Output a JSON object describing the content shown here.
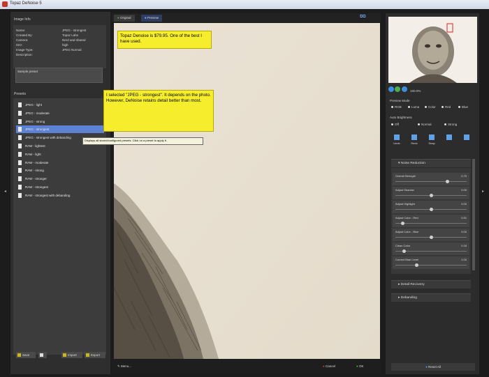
{
  "window": {
    "title": "Topaz DeNoise 5"
  },
  "image_info": {
    "header": "Image Info",
    "rows": [
      {
        "k": "Name:",
        "v": "JPEG - strongest"
      },
      {
        "k": "Created By:",
        "v": "Topaz Labs"
      },
      {
        "k": "Camera:",
        "v": "Nerd and shared"
      },
      {
        "k": "ISO:",
        "v": "high"
      },
      {
        "k": "Image Type:",
        "v": "JPEG Normal"
      },
      {
        "k": "Description:",
        "v": ""
      }
    ],
    "description": "Sample preset"
  },
  "presets": {
    "header": "Presets",
    "items": [
      "JPEG - light",
      "JPEG - moderate",
      "JPEG - strong",
      "JPEG - strongest",
      "JPEG - strongest with debanding",
      "RAW - lightest",
      "RAW - light",
      "RAW - moderate",
      "RAW - strong",
      "RAW - stronger",
      "RAW - strongest",
      "RAW - strongest with debanding"
    ],
    "selected_index": 3,
    "tooltip": "Displays all stored/configured presets. Click on a preset to apply it."
  },
  "left_buttons": {
    "save": "Save",
    "import": "Import",
    "export": "Export"
  },
  "tabs": [
    {
      "label": "Original"
    },
    {
      "label": "Preview"
    }
  ],
  "notes": {
    "note1": "Topaz Denoise is $79.95. One of the best I have used.",
    "note2": "I selected \"JPEG - strongest\". It depends on the photo. However, DeNoise retains detail better than most."
  },
  "center_buttons": {
    "menu": "Menu...",
    "cancel": "Cancel",
    "ok": "OK"
  },
  "right": {
    "zoom_label": "100.0%",
    "preview_mode": {
      "label": "Preview Mode",
      "options": [
        "RGB",
        "Luma",
        "Color",
        "Red",
        "Blue"
      ]
    },
    "auto_brightness": {
      "label": "Auto Brightness",
      "options": [
        "Off",
        "Normal",
        "Strong"
      ]
    },
    "tools": [
      "Undo",
      "Redo",
      "Snap",
      "",
      ""
    ],
    "sections": [
      "Noise Reduction",
      "Detail Recovery",
      "Debanding"
    ],
    "sliders": [
      {
        "label": "Overall Strength",
        "value": "0.70",
        "pos": 0.73
      },
      {
        "label": "Adjust Shadow",
        "value": "0.00",
        "pos": 0.5
      },
      {
        "label": "Adjust Highlight",
        "value": "0.00",
        "pos": 0.5
      },
      {
        "label": "Adjust Color - Red",
        "value": "0.51",
        "pos": 0.1
      },
      {
        "label": "Adjust Color - Blue",
        "value": "0.00",
        "pos": 0.5
      },
      {
        "label": "Clean Color",
        "value": "0.18",
        "pos": 0.12
      },
      {
        "label": "Correct Blue Level",
        "value": "1.00",
        "pos": 0.3
      }
    ],
    "reset_label": "Reset All"
  }
}
